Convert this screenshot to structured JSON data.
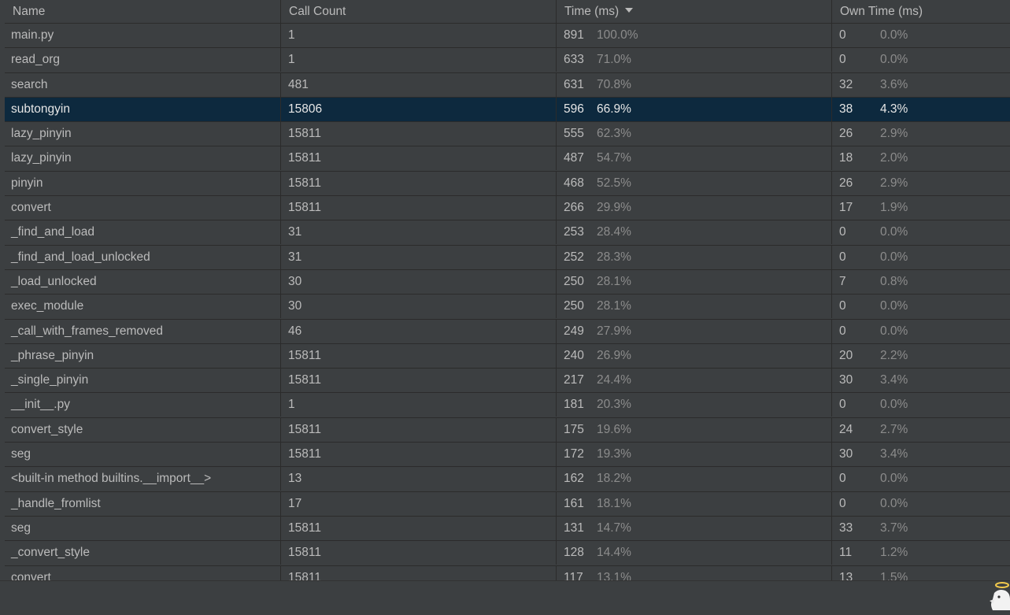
{
  "columns": {
    "name": "Name",
    "call_count": "Call Count",
    "time": "Time (ms)",
    "own_time": "Own Time (ms)"
  },
  "sort": {
    "column": "time",
    "direction": "descending",
    "icon": "sort-descending-icon"
  },
  "selected_row_index": 3,
  "rows": [
    {
      "name": "main.py",
      "calls": "1",
      "time": "891",
      "time_pct": "100.0%",
      "own": "0",
      "own_pct": "0.0%"
    },
    {
      "name": "read_org",
      "calls": "1",
      "time": "633",
      "time_pct": "71.0%",
      "own": "0",
      "own_pct": "0.0%"
    },
    {
      "name": "search",
      "calls": "481",
      "time": "631",
      "time_pct": "70.8%",
      "own": "32",
      "own_pct": "3.6%"
    },
    {
      "name": "subtongyin",
      "calls": "15806",
      "time": "596",
      "time_pct": "66.9%",
      "own": "38",
      "own_pct": "4.3%"
    },
    {
      "name": "lazy_pinyin",
      "calls": "15811",
      "time": "555",
      "time_pct": "62.3%",
      "own": "26",
      "own_pct": "2.9%"
    },
    {
      "name": "lazy_pinyin",
      "calls": "15811",
      "time": "487",
      "time_pct": "54.7%",
      "own": "18",
      "own_pct": "2.0%"
    },
    {
      "name": "pinyin",
      "calls": "15811",
      "time": "468",
      "time_pct": "52.5%",
      "own": "26",
      "own_pct": "2.9%"
    },
    {
      "name": "convert",
      "calls": "15811",
      "time": "266",
      "time_pct": "29.9%",
      "own": "17",
      "own_pct": "1.9%"
    },
    {
      "name": "_find_and_load",
      "calls": "31",
      "time": "253",
      "time_pct": "28.4%",
      "own": "0",
      "own_pct": "0.0%"
    },
    {
      "name": "_find_and_load_unlocked",
      "calls": "31",
      "time": "252",
      "time_pct": "28.3%",
      "own": "0",
      "own_pct": "0.0%"
    },
    {
      "name": "_load_unlocked",
      "calls": "30",
      "time": "250",
      "time_pct": "28.1%",
      "own": "7",
      "own_pct": "0.8%"
    },
    {
      "name": "exec_module",
      "calls": "30",
      "time": "250",
      "time_pct": "28.1%",
      "own": "0",
      "own_pct": "0.0%"
    },
    {
      "name": "_call_with_frames_removed",
      "calls": "46",
      "time": "249",
      "time_pct": "27.9%",
      "own": "0",
      "own_pct": "0.0%"
    },
    {
      "name": "_phrase_pinyin",
      "calls": "15811",
      "time": "240",
      "time_pct": "26.9%",
      "own": "20",
      "own_pct": "2.2%"
    },
    {
      "name": "_single_pinyin",
      "calls": "15811",
      "time": "217",
      "time_pct": "24.4%",
      "own": "30",
      "own_pct": "3.4%"
    },
    {
      "name": "__init__.py",
      "calls": "1",
      "time": "181",
      "time_pct": "20.3%",
      "own": "0",
      "own_pct": "0.0%"
    },
    {
      "name": "convert_style",
      "calls": "15811",
      "time": "175",
      "time_pct": "19.6%",
      "own": "24",
      "own_pct": "2.7%"
    },
    {
      "name": "seg",
      "calls": "15811",
      "time": "172",
      "time_pct": "19.3%",
      "own": "30",
      "own_pct": "3.4%"
    },
    {
      "name": "<built-in method builtins.__import__>",
      "calls": "13",
      "time": "162",
      "time_pct": "18.2%",
      "own": "0",
      "own_pct": "0.0%"
    },
    {
      "name": "_handle_fromlist",
      "calls": "17",
      "time": "161",
      "time_pct": "18.1%",
      "own": "0",
      "own_pct": "0.0%"
    },
    {
      "name": "seg",
      "calls": "15811",
      "time": "131",
      "time_pct": "14.7%",
      "own": "33",
      "own_pct": "3.7%"
    },
    {
      "name": "_convert_style",
      "calls": "15811",
      "time": "128",
      "time_pct": "14.4%",
      "own": "11",
      "own_pct": "1.2%"
    },
    {
      "name": "convert",
      "calls": "15811",
      "time": "117",
      "time_pct": "13.1%",
      "own": "13",
      "own_pct": "1.5%"
    }
  ],
  "colors": {
    "background": "#3c3f41",
    "selected_row": "#0d293e",
    "grid_line": "#2b2b2b",
    "text": "#bbbbbb",
    "percent_text": "#8c8c8c"
  },
  "status_bar": {
    "mascot_icon": "angel-mascot-icon"
  }
}
